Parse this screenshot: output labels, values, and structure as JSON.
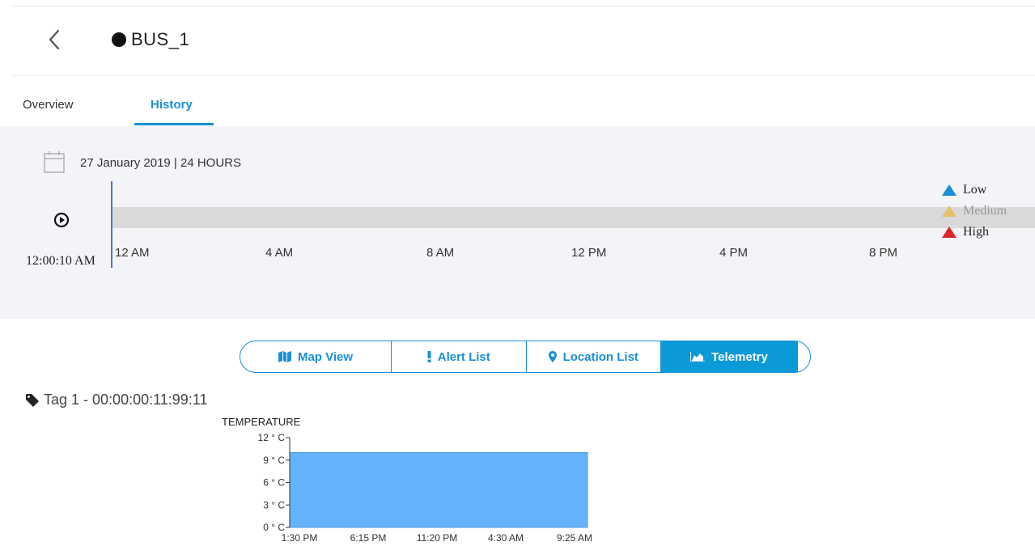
{
  "header": {
    "title": "BUS_1"
  },
  "tabs": [
    {
      "label": "Overview",
      "active": false
    },
    {
      "label": "History",
      "active": true
    }
  ],
  "timeline": {
    "date_range": "27 January 2019 | 24 HOURS",
    "current_time": "12:00:10 AM",
    "ticks": [
      "12 AM",
      "4 AM",
      "8 AM",
      "12 PM",
      "4 PM",
      "8 PM"
    ]
  },
  "legend": [
    {
      "label": "Low",
      "color": "#1a8fd8"
    },
    {
      "label": "Medium",
      "color": "#e4c26a"
    },
    {
      "label": "High",
      "color": "#e0242b"
    }
  ],
  "views": [
    {
      "label": "Map View",
      "icon": "map-icon",
      "active": false
    },
    {
      "label": "Alert List",
      "icon": "exclamation-icon",
      "active": false
    },
    {
      "label": "Location List",
      "icon": "location-pin-icon",
      "active": false
    },
    {
      "label": "Telemetry",
      "icon": "area-chart-icon",
      "active": true
    }
  ],
  "tag": {
    "label": "Tag 1 - 00:00:00:11:99:11"
  },
  "colors": {
    "accent": "#1a8fd8",
    "chart_fill": "#66b3fb"
  },
  "chart_data": {
    "type": "area",
    "ylabel": "TEMPERATURE",
    "y_ticks": [
      "0 ° C",
      "3 ° C",
      "6 ° C",
      "9 ° C",
      "12 ° C"
    ],
    "y_tick_values": [
      0,
      3,
      6,
      9,
      12
    ],
    "ylim": [
      0,
      12
    ],
    "x_ticks": [
      "1:30 PM",
      "6:15 PM",
      "11:20 PM",
      "4:30 AM",
      "9:25 AM"
    ],
    "series": [
      {
        "values": [
          10,
          10,
          10,
          10,
          10,
          10
        ]
      }
    ],
    "grid": false
  }
}
